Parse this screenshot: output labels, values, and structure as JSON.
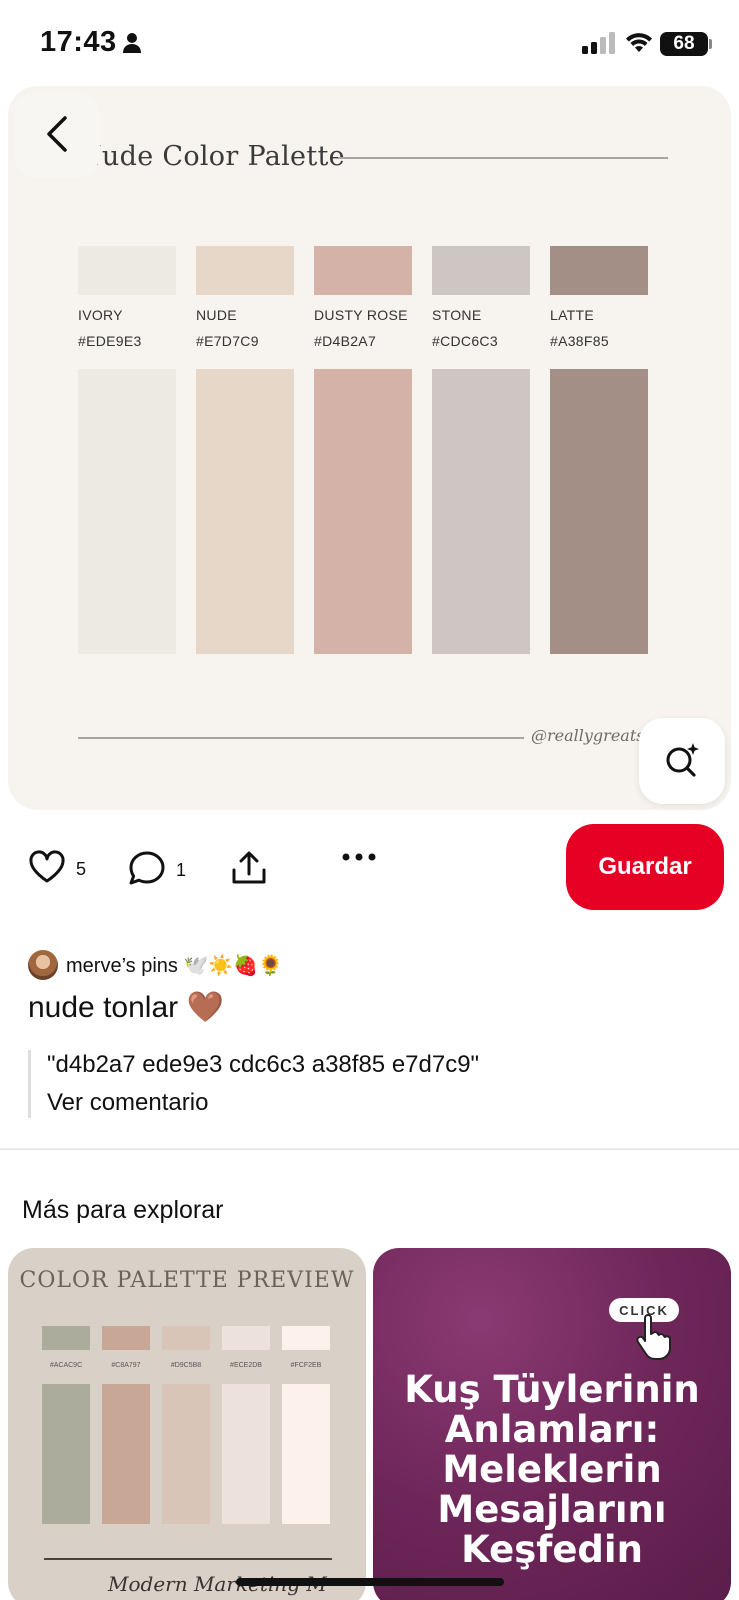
{
  "status_bar": {
    "time": "17:43",
    "battery": "68"
  },
  "pin": {
    "image": {
      "title": "Nude Color Palette",
      "credit": "@reallygreatsite",
      "swatches": [
        {
          "name": "IVORY",
          "hex": "#EDE9E3",
          "color": "#EDE9E3"
        },
        {
          "name": "NUDE",
          "hex": "#E7D7C9",
          "color": "#E7D7C9"
        },
        {
          "name": "DUSTY ROSE",
          "hex": "#D4B2A7",
          "color": "#D4B2A7"
        },
        {
          "name": "STONE",
          "hex": "#CDC6C3",
          "color": "#CDC6C3"
        },
        {
          "name": "LATTE",
          "hex": "#A38F85",
          "color": "#A38F85"
        }
      ]
    },
    "actions": {
      "likes": "5",
      "comments": "1",
      "save_label": "Guardar"
    },
    "board_name": "merve’s pins 🕊️☀️🍓🌻",
    "title": "nude tonlar 🤎",
    "comment_text": "\"d4b2a7 ede9e3 cdc6c3 a38f85 e7d7c9\"",
    "comment_link": "Ver comentario"
  },
  "explore": {
    "heading": "Más para explorar",
    "cards": [
      {
        "title": "COLOR PALETTE PREVIEW",
        "signature": "Modern Marketing M",
        "swatches": [
          {
            "hex": "#ACAC9C",
            "color": "#ACAC9C"
          },
          {
            "hex": "#C8A797",
            "color": "#C8A797"
          },
          {
            "hex": "#D9C5B8",
            "color": "#D9C5B8"
          },
          {
            "hex": "#ECE2DB",
            "color": "#ECE2DB"
          },
          {
            "hex": "#FCF2EB",
            "color": "#FCF2EB"
          }
        ]
      },
      {
        "pill": "CLICK",
        "text": "Kuş Tüylerinin Anlamları: Meleklerin Mesajlarını Keşfedin"
      }
    ]
  },
  "colors": {
    "accent": "#e60023",
    "hero_bg": "#f7f3ef",
    "card_purple": "#6e2659"
  }
}
